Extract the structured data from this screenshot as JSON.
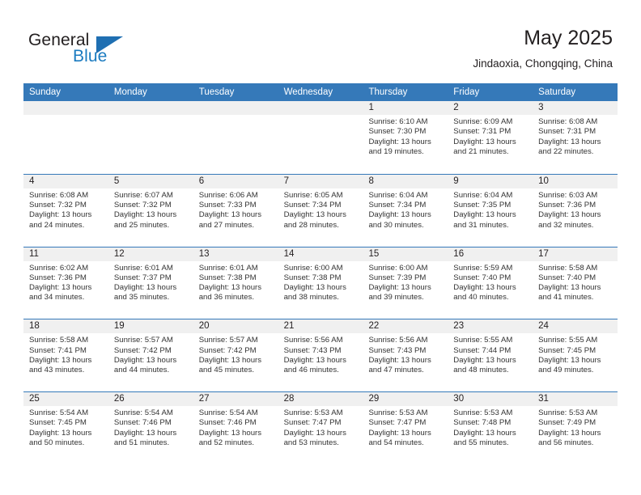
{
  "brand": {
    "name_part1": "General",
    "name_part2": "Blue",
    "accent_color": "#1f6fb2"
  },
  "header": {
    "title": "May 2025",
    "subtitle": "Jindaoxia, Chongqing, China"
  },
  "calendar": {
    "header_bg": "#3579b9",
    "daynum_bg": "#f0f0f0",
    "weekdays": [
      "Sunday",
      "Monday",
      "Tuesday",
      "Wednesday",
      "Thursday",
      "Friday",
      "Saturday"
    ],
    "weeks": [
      [
        {
          "day": "",
          "empty": true
        },
        {
          "day": "",
          "empty": true
        },
        {
          "day": "",
          "empty": true
        },
        {
          "day": "",
          "empty": true
        },
        {
          "day": "1",
          "sunrise": "Sunrise: 6:10 AM",
          "sunset": "Sunset: 7:30 PM",
          "daylight1": "Daylight: 13 hours",
          "daylight2": "and 19 minutes."
        },
        {
          "day": "2",
          "sunrise": "Sunrise: 6:09 AM",
          "sunset": "Sunset: 7:31 PM",
          "daylight1": "Daylight: 13 hours",
          "daylight2": "and 21 minutes."
        },
        {
          "day": "3",
          "sunrise": "Sunrise: 6:08 AM",
          "sunset": "Sunset: 7:31 PM",
          "daylight1": "Daylight: 13 hours",
          "daylight2": "and 22 minutes."
        }
      ],
      [
        {
          "day": "4",
          "sunrise": "Sunrise: 6:08 AM",
          "sunset": "Sunset: 7:32 PM",
          "daylight1": "Daylight: 13 hours",
          "daylight2": "and 24 minutes."
        },
        {
          "day": "5",
          "sunrise": "Sunrise: 6:07 AM",
          "sunset": "Sunset: 7:32 PM",
          "daylight1": "Daylight: 13 hours",
          "daylight2": "and 25 minutes."
        },
        {
          "day": "6",
          "sunrise": "Sunrise: 6:06 AM",
          "sunset": "Sunset: 7:33 PM",
          "daylight1": "Daylight: 13 hours",
          "daylight2": "and 27 minutes."
        },
        {
          "day": "7",
          "sunrise": "Sunrise: 6:05 AM",
          "sunset": "Sunset: 7:34 PM",
          "daylight1": "Daylight: 13 hours",
          "daylight2": "and 28 minutes."
        },
        {
          "day": "8",
          "sunrise": "Sunrise: 6:04 AM",
          "sunset": "Sunset: 7:34 PM",
          "daylight1": "Daylight: 13 hours",
          "daylight2": "and 30 minutes."
        },
        {
          "day": "9",
          "sunrise": "Sunrise: 6:04 AM",
          "sunset": "Sunset: 7:35 PM",
          "daylight1": "Daylight: 13 hours",
          "daylight2": "and 31 minutes."
        },
        {
          "day": "10",
          "sunrise": "Sunrise: 6:03 AM",
          "sunset": "Sunset: 7:36 PM",
          "daylight1": "Daylight: 13 hours",
          "daylight2": "and 32 minutes."
        }
      ],
      [
        {
          "day": "11",
          "sunrise": "Sunrise: 6:02 AM",
          "sunset": "Sunset: 7:36 PM",
          "daylight1": "Daylight: 13 hours",
          "daylight2": "and 34 minutes."
        },
        {
          "day": "12",
          "sunrise": "Sunrise: 6:01 AM",
          "sunset": "Sunset: 7:37 PM",
          "daylight1": "Daylight: 13 hours",
          "daylight2": "and 35 minutes."
        },
        {
          "day": "13",
          "sunrise": "Sunrise: 6:01 AM",
          "sunset": "Sunset: 7:38 PM",
          "daylight1": "Daylight: 13 hours",
          "daylight2": "and 36 minutes."
        },
        {
          "day": "14",
          "sunrise": "Sunrise: 6:00 AM",
          "sunset": "Sunset: 7:38 PM",
          "daylight1": "Daylight: 13 hours",
          "daylight2": "and 38 minutes."
        },
        {
          "day": "15",
          "sunrise": "Sunrise: 6:00 AM",
          "sunset": "Sunset: 7:39 PM",
          "daylight1": "Daylight: 13 hours",
          "daylight2": "and 39 minutes."
        },
        {
          "day": "16",
          "sunrise": "Sunrise: 5:59 AM",
          "sunset": "Sunset: 7:40 PM",
          "daylight1": "Daylight: 13 hours",
          "daylight2": "and 40 minutes."
        },
        {
          "day": "17",
          "sunrise": "Sunrise: 5:58 AM",
          "sunset": "Sunset: 7:40 PM",
          "daylight1": "Daylight: 13 hours",
          "daylight2": "and 41 minutes."
        }
      ],
      [
        {
          "day": "18",
          "sunrise": "Sunrise: 5:58 AM",
          "sunset": "Sunset: 7:41 PM",
          "daylight1": "Daylight: 13 hours",
          "daylight2": "and 43 minutes."
        },
        {
          "day": "19",
          "sunrise": "Sunrise: 5:57 AM",
          "sunset": "Sunset: 7:42 PM",
          "daylight1": "Daylight: 13 hours",
          "daylight2": "and 44 minutes."
        },
        {
          "day": "20",
          "sunrise": "Sunrise: 5:57 AM",
          "sunset": "Sunset: 7:42 PM",
          "daylight1": "Daylight: 13 hours",
          "daylight2": "and 45 minutes."
        },
        {
          "day": "21",
          "sunrise": "Sunrise: 5:56 AM",
          "sunset": "Sunset: 7:43 PM",
          "daylight1": "Daylight: 13 hours",
          "daylight2": "and 46 minutes."
        },
        {
          "day": "22",
          "sunrise": "Sunrise: 5:56 AM",
          "sunset": "Sunset: 7:43 PM",
          "daylight1": "Daylight: 13 hours",
          "daylight2": "and 47 minutes."
        },
        {
          "day": "23",
          "sunrise": "Sunrise: 5:55 AM",
          "sunset": "Sunset: 7:44 PM",
          "daylight1": "Daylight: 13 hours",
          "daylight2": "and 48 minutes."
        },
        {
          "day": "24",
          "sunrise": "Sunrise: 5:55 AM",
          "sunset": "Sunset: 7:45 PM",
          "daylight1": "Daylight: 13 hours",
          "daylight2": "and 49 minutes."
        }
      ],
      [
        {
          "day": "25",
          "sunrise": "Sunrise: 5:54 AM",
          "sunset": "Sunset: 7:45 PM",
          "daylight1": "Daylight: 13 hours",
          "daylight2": "and 50 minutes."
        },
        {
          "day": "26",
          "sunrise": "Sunrise: 5:54 AM",
          "sunset": "Sunset: 7:46 PM",
          "daylight1": "Daylight: 13 hours",
          "daylight2": "and 51 minutes."
        },
        {
          "day": "27",
          "sunrise": "Sunrise: 5:54 AM",
          "sunset": "Sunset: 7:46 PM",
          "daylight1": "Daylight: 13 hours",
          "daylight2": "and 52 minutes."
        },
        {
          "day": "28",
          "sunrise": "Sunrise: 5:53 AM",
          "sunset": "Sunset: 7:47 PM",
          "daylight1": "Daylight: 13 hours",
          "daylight2": "and 53 minutes."
        },
        {
          "day": "29",
          "sunrise": "Sunrise: 5:53 AM",
          "sunset": "Sunset: 7:47 PM",
          "daylight1": "Daylight: 13 hours",
          "daylight2": "and 54 minutes."
        },
        {
          "day": "30",
          "sunrise": "Sunrise: 5:53 AM",
          "sunset": "Sunset: 7:48 PM",
          "daylight1": "Daylight: 13 hours",
          "daylight2": "and 55 minutes."
        },
        {
          "day": "31",
          "sunrise": "Sunrise: 5:53 AM",
          "sunset": "Sunset: 7:49 PM",
          "daylight1": "Daylight: 13 hours",
          "daylight2": "and 56 minutes."
        }
      ]
    ]
  }
}
